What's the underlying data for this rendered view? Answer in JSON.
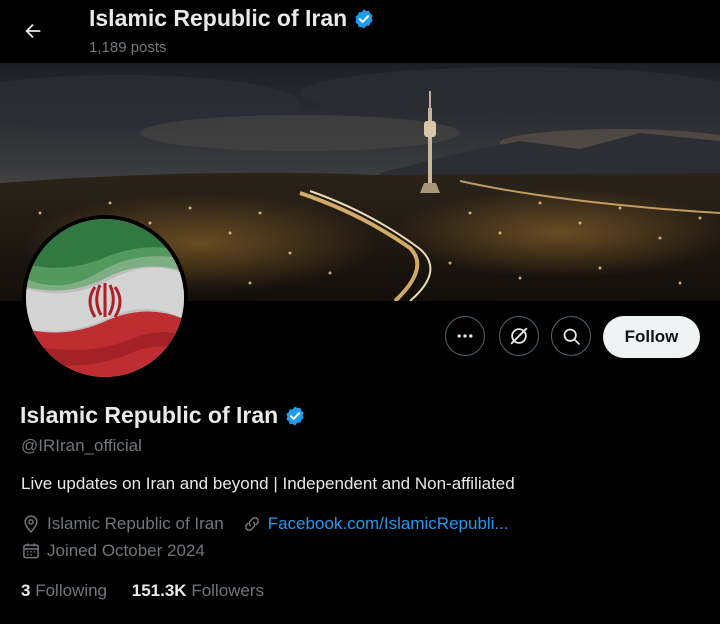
{
  "header": {
    "title": "Islamic Republic of Iran",
    "post_count": "1,189 posts",
    "back_icon": "arrow-left-icon"
  },
  "profile": {
    "name": "Islamic Republic of Iran",
    "handle": "@IRIran_official",
    "bio": "Live updates on Iran and beyond | Independent and Non-affiliated",
    "location": "Islamic Republic of Iran",
    "website": "Facebook.com/IslamicRepubli...",
    "joined": "Joined October 2024",
    "verified": true
  },
  "actions": {
    "more_icon": "more-icon",
    "grok_icon": "grok-icon",
    "search_icon": "search-icon",
    "follow_label": "Follow"
  },
  "stats": {
    "following_count": "3",
    "following_label": "Following",
    "followers_count": "151.3K",
    "followers_label": "Followers"
  },
  "colors": {
    "background": "#000000",
    "text": "#e7e9ea",
    "muted": "#71767b",
    "link": "#1d9bf0",
    "verified": "#1d9bf0",
    "follow_bg": "#eff3f4"
  }
}
